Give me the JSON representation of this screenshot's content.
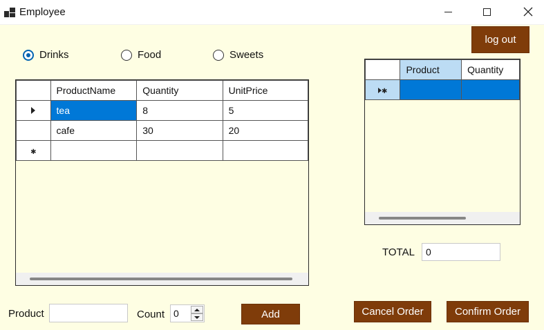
{
  "window": {
    "title": "Employee",
    "icon": "app-window-icon"
  },
  "logout_label": "log out",
  "categories": [
    {
      "label": "Drinks",
      "checked": true
    },
    {
      "label": "Food",
      "checked": false
    },
    {
      "label": "Sweets",
      "checked": false
    }
  ],
  "products_grid": {
    "columns": [
      "ProductName",
      "Quantity",
      "UnitPrice"
    ],
    "rows": [
      {
        "ProductName": "tea",
        "Quantity": "8",
        "UnitPrice": "5"
      },
      {
        "ProductName": "cafe",
        "Quantity": "30",
        "UnitPrice": "20"
      }
    ],
    "selected_row": 0
  },
  "order_grid": {
    "columns": [
      "Product",
      "Quantity"
    ]
  },
  "total": {
    "label": "TOTAL",
    "value": "0"
  },
  "product_field": {
    "label": "Product",
    "value": ""
  },
  "count_field": {
    "label": "Count",
    "value": "0"
  },
  "buttons": {
    "add": "Add",
    "cancel_order": "Cancel Order",
    "confirm_order": "Confirm Order"
  },
  "colors": {
    "background": "#fefee3",
    "button_brown": "#7f3c0a",
    "selection_blue": "#0078d7",
    "header_highlight": "#bcdcf4"
  }
}
